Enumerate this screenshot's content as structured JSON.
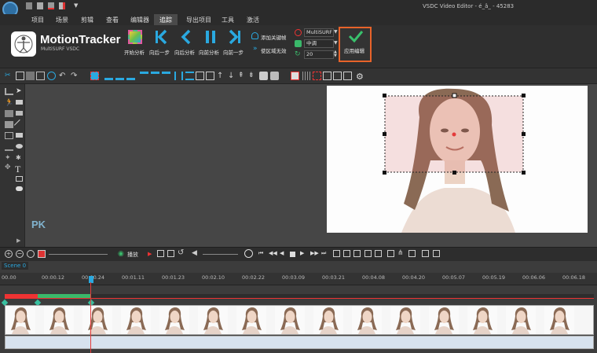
{
  "window": {
    "title": "VSDC Video Editor - é_â_ - 45283"
  },
  "menu": {
    "items": [
      "项目",
      "场景",
      "剪辑",
      "查看",
      "编辑器",
      "追踪",
      "导出项目",
      "工具",
      "激活"
    ],
    "active_index": 5
  },
  "ribbon": {
    "plugin_name": "MotionTracker",
    "plugin_sub": "MultiSURF VSDC",
    "analysis_buttons": [
      "开始分析",
      "向后一步",
      "向后分析",
      "向前分析",
      "向前一步"
    ],
    "add_keyframe": "添加关键帧",
    "invalid_region": "使区域无效",
    "algorithm": "MultiSURF",
    "quality": "中调",
    "value": "20",
    "apply_label": "应用编辑"
  },
  "timeline": {
    "scene_tab": "Scene 0",
    "ticks": [
      "00.00",
      "00:00.12",
      "00:00.24",
      "00:01.11",
      "00:01.23",
      "00:02.10",
      "00:02.22",
      "00:03.09",
      "00:03.21",
      "00:04.08",
      "00:04.20",
      "00:05.07",
      "00:05.19",
      "00:06.06",
      "00:06.18"
    ]
  },
  "transport": {
    "play_label": "播放"
  },
  "watermark": {
    "text": "PK"
  },
  "colors": {
    "accent": "#2aa9e0",
    "highlight_box": "#e8632a",
    "apply_check": "#39c16c",
    "playhead": "#e43b3b"
  }
}
